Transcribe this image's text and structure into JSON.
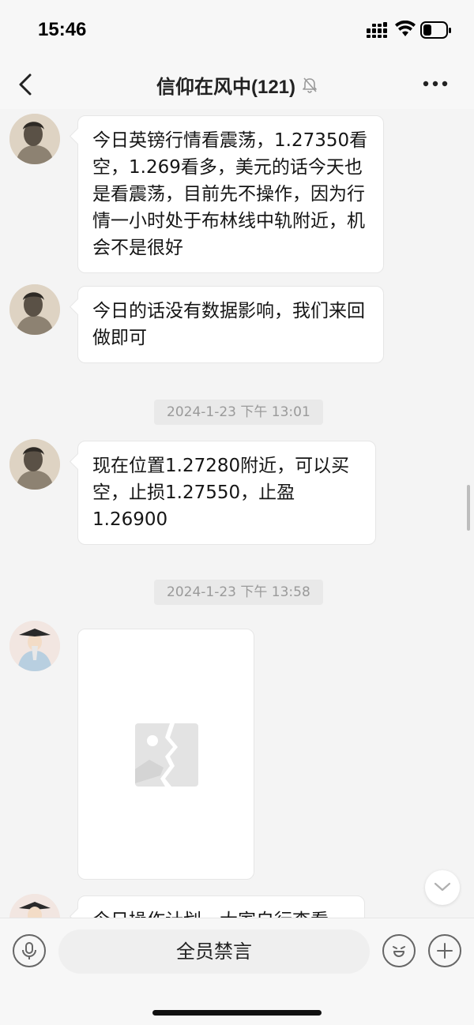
{
  "status_bar": {
    "time": "15:46"
  },
  "nav": {
    "title": "信仰在风中(121)"
  },
  "messages": [
    {
      "type": "text",
      "text": "今日英镑行情看震荡，1.27350看空，1.269看多，美元的话今天也是看震荡，目前先不操作，因为行情一小时处于布林线中轨附近，机会不是很好"
    },
    {
      "type": "text",
      "text": "今日的话没有数据影响，我们来回做即可"
    },
    {
      "type": "timestamp",
      "text": "2024-1-23 下午 13:01"
    },
    {
      "type": "text",
      "text": "现在位置1.27280附近，可以买空，止损1.27550，止盈1.26900"
    },
    {
      "type": "timestamp",
      "text": "2024-1-23 下午 13:58"
    },
    {
      "type": "image",
      "icon": "image-placeholder-icon"
    },
    {
      "type": "text",
      "text": "今日操作计划，大家自行查看"
    }
  ],
  "input_bar": {
    "mute_text": "全员禁言"
  },
  "colors": {
    "background": "#f4f4f4",
    "bubble": "#ffffff",
    "timestamp_bg": "#e9e9e9",
    "timestamp_text": "#9a9a9a"
  }
}
